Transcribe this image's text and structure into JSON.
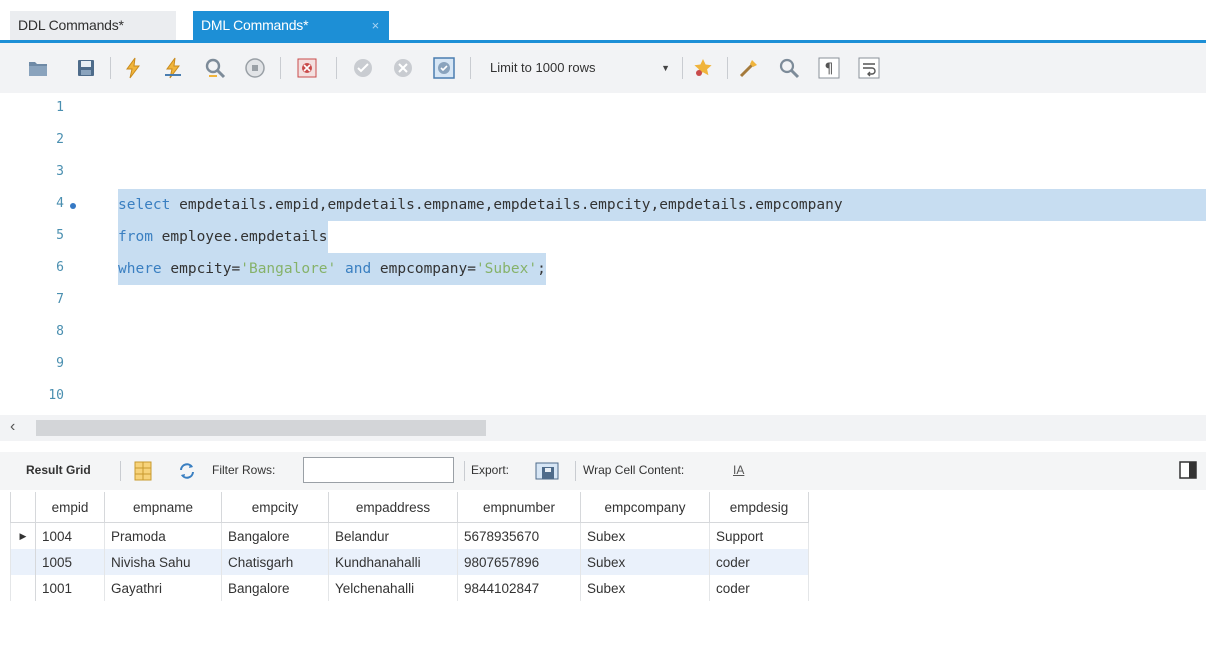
{
  "tabs": [
    {
      "label": "DDL Commands*",
      "active": false
    },
    {
      "label": "DML Commands*",
      "active": true
    }
  ],
  "tab_close_glyph": "×",
  "toolbar": {
    "icons": [
      "open-file-icon",
      "save-icon",
      "execute-icon",
      "execute-current-icon",
      "explain-icon",
      "stop-icon",
      "toggle-error-icon",
      "commit-icon",
      "rollback-icon",
      "autocommit-icon",
      "beautify-icon",
      "find-icon",
      "invisible-chars-icon",
      "wrap-icon"
    ],
    "limit_label": "Limit to 1000 rows"
  },
  "editor": {
    "line_numbers": [
      "1",
      "2",
      "3",
      "4",
      "5",
      "6",
      "7",
      "8",
      "9",
      "10"
    ],
    "active_line": "4",
    "code": {
      "line4_kw": "select",
      "line4_rest": " empdetails.empid,empdetails.empname,empdetails.empcity,empdetails.empcompany",
      "line5_kw": "from",
      "line5_rest": " employee.empdetails",
      "line6_kw1": "where",
      "line6_mid1": " empcity=",
      "line6_str1": "'Bangalore'",
      "line6_kw2": " and",
      "line6_mid2": " empcompany=",
      "line6_str2": "'Subex'",
      "line6_end": ";"
    },
    "scroll_left_glyph": "‹"
  },
  "result_toolbar": {
    "result_grid_label": "Result Grid",
    "filter_rows_label": "Filter Rows:",
    "filter_value": "",
    "export_label": "Export:",
    "wrap_label": "Wrap Cell Content:",
    "wrap_icon_glyph": "IA"
  },
  "grid": {
    "columns": [
      "empid",
      "empname",
      "empcity",
      "empaddress",
      "empnumber",
      "empcompany",
      "empdesig"
    ],
    "rows": [
      [
        "1004",
        "Pramoda",
        "Bangalore",
        "Belandur",
        "5678935670",
        "Subex",
        "Support"
      ],
      [
        "1005",
        "Nivisha Sahu",
        "Chatisgarh",
        "Kundhanahalli",
        "9807657896",
        "Subex",
        "coder"
      ],
      [
        "1001",
        "Gayathri",
        "Bangalore",
        "Yelchenahalli",
        "9844102847",
        "Subex",
        "coder"
      ]
    ],
    "current_row_marker": "▶"
  },
  "colors": {
    "accent": "#1d8fd6",
    "selection": "#c7ddf1",
    "keyword": "#3a7fc1",
    "string": "#86b26a",
    "line_number": "#4a8fb0"
  }
}
